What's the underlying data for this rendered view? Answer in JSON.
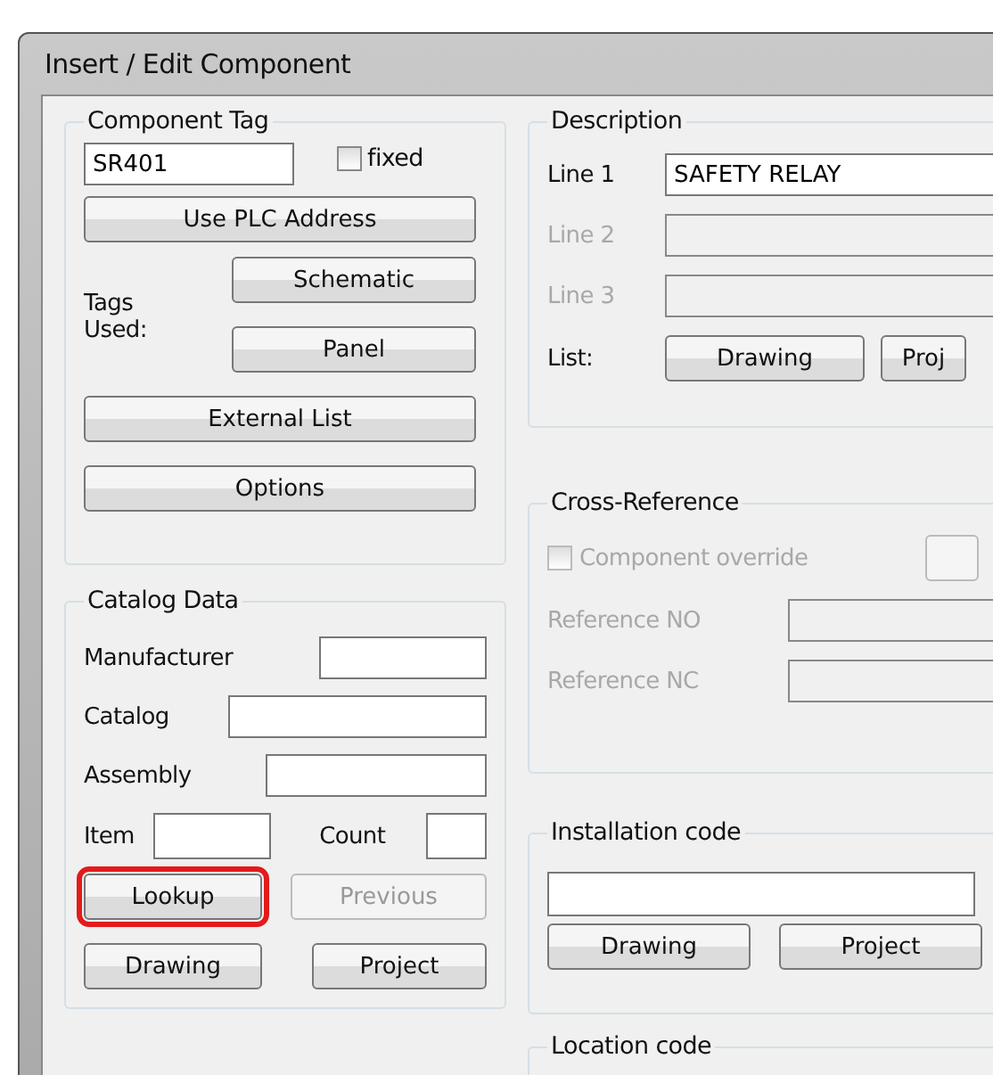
{
  "window": {
    "title": "Insert / Edit Component"
  },
  "component_tag": {
    "title": "Component Tag",
    "value": "SR401",
    "fixed": {
      "label": "fixed",
      "checked": false
    },
    "plc_button": {
      "label": "Use PLC Address",
      "disabled": false,
      "highlighted": false
    },
    "tags_used_label": "Tags Used:",
    "tags_buttons": [
      {
        "label": "Schematic",
        "disabled": false,
        "highlighted": false
      },
      {
        "label": "Panel",
        "disabled": false,
        "highlighted": false
      }
    ],
    "buttons": [
      {
        "label": "External List",
        "disabled": false,
        "highlighted": false
      },
      {
        "label": "Options",
        "disabled": false,
        "highlighted": false
      }
    ]
  },
  "catalog_data": {
    "title": "Catalog Data",
    "fields": [
      {
        "label": "Manufacturer"
      },
      {
        "label": "Catalog"
      },
      {
        "label": "Assembly"
      }
    ],
    "item": {
      "label": "Item"
    },
    "count": {
      "label": "Count"
    },
    "buttons": [
      {
        "label": "Lookup",
        "disabled": false,
        "highlighted": true
      },
      {
        "label": "Previous",
        "disabled": true,
        "highlighted": false
      },
      {
        "label": "Drawing",
        "disabled": false,
        "highlighted": false
      },
      {
        "label": "Project",
        "disabled": false,
        "highlighted": false
      }
    ]
  },
  "description": {
    "title": "Description",
    "lines": [
      {
        "label": "Line 1",
        "value": "SAFETY RELAY",
        "disabled": false
      },
      {
        "label": "Line 2",
        "disabled": true
      },
      {
        "label": "Line 3",
        "disabled": true
      }
    ],
    "list_label": "List:",
    "buttons": [
      {
        "label": "Drawing",
        "disabled": false,
        "highlighted": false
      },
      {
        "label": "Proj",
        "disabled": false,
        "highlighted": false
      }
    ]
  },
  "cross_reference": {
    "title": "Cross-Reference",
    "override": {
      "label": "Component override",
      "checked": false,
      "disabled": true
    },
    "fields": [
      {
        "label": "Reference NO"
      },
      {
        "label": "Reference NC"
      }
    ]
  },
  "installation_code": {
    "title": "Installation code",
    "buttons": [
      {
        "label": "Drawing",
        "disabled": false,
        "highlighted": false
      },
      {
        "label": "Project",
        "disabled": false,
        "highlighted": false
      }
    ]
  },
  "location_code": {
    "title": "Location code"
  }
}
